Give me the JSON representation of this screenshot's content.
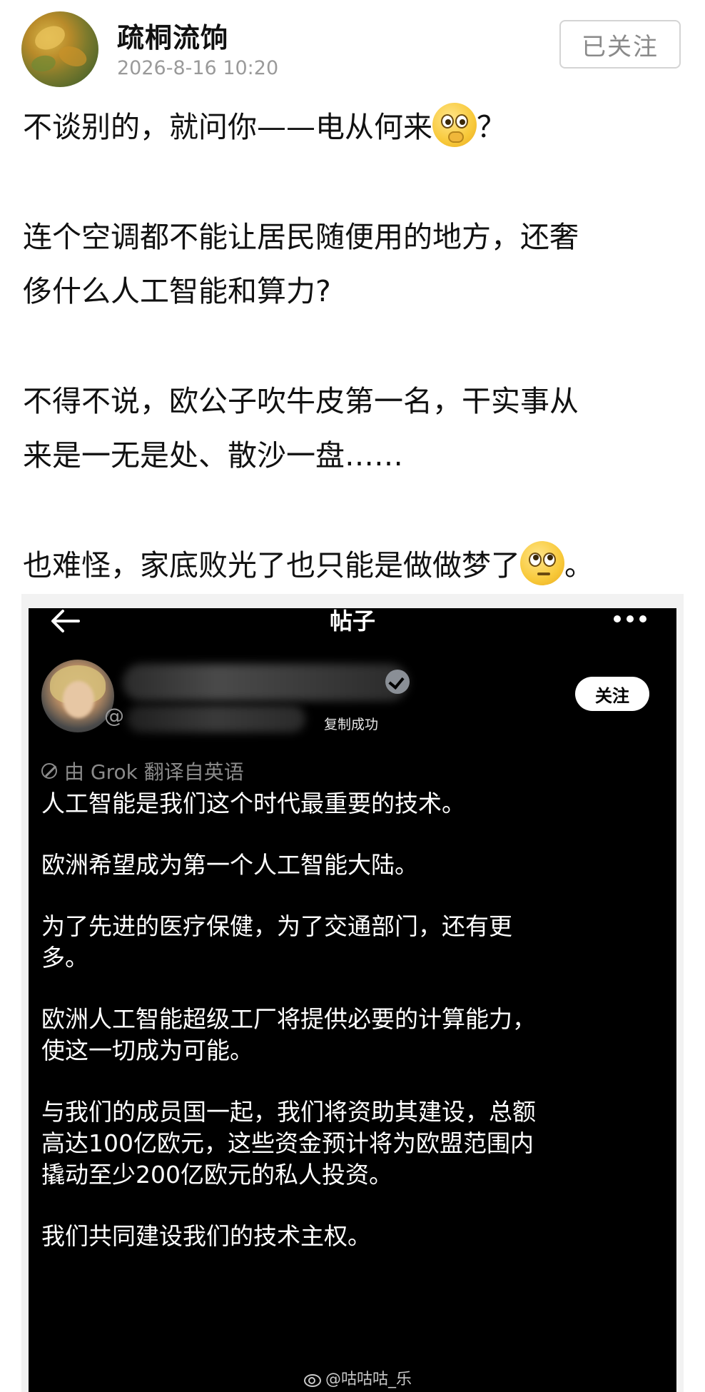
{
  "header": {
    "username": "疏桐流饷",
    "timestamp": "2026-8-16 10:20",
    "follow_button": "已关注"
  },
  "post": {
    "paragraphs": [
      {
        "lines": [
          "不谈别的，就问你——电从何来"
        ],
        "emoji": "shushing-face-icon",
        "tail": "？"
      },
      {
        "lines": [
          "连个空调都不能让居民随便用的地方，还奢",
          "侈什么人工智能和算力?"
        ]
      },
      {
        "lines": [
          "不得不说，欧公子吹牛皮第一名，干实事从",
          "来是一无是处、散沙一盘……"
        ]
      },
      {
        "lines": [
          "也难怪，家底败光了也只能是做做梦了"
        ],
        "emoji": "eye-roll-face-icon",
        "tail": "。"
      }
    ]
  },
  "embedded": {
    "title": "帖子",
    "follow_button": "关注",
    "handle_prefix": "@",
    "toast": "复制成功",
    "translation_note": "由 Grok 翻译自英语",
    "tweet": [
      [
        "人工智能是我们这个时代最重要的技术。"
      ],
      [
        "欧洲希望成为第一个人工智能大陆。"
      ],
      [
        "为了先进的医疗保健，为了交通部门，还有更",
        "多。"
      ],
      [
        "欧洲人工智能超级工厂将提供必要的计算能力，",
        "使这一切成为可能。"
      ],
      [
        "与我们的成员国一起，我们将资助其建设，总额",
        "高达100亿欧元，这些资金预计将为欧盟范围内",
        "撬动至少200亿欧元的私人投资。"
      ],
      [
        "我们共同建设我们的技术主权。"
      ]
    ]
  },
  "watermark": "@咕咕咕_乐"
}
